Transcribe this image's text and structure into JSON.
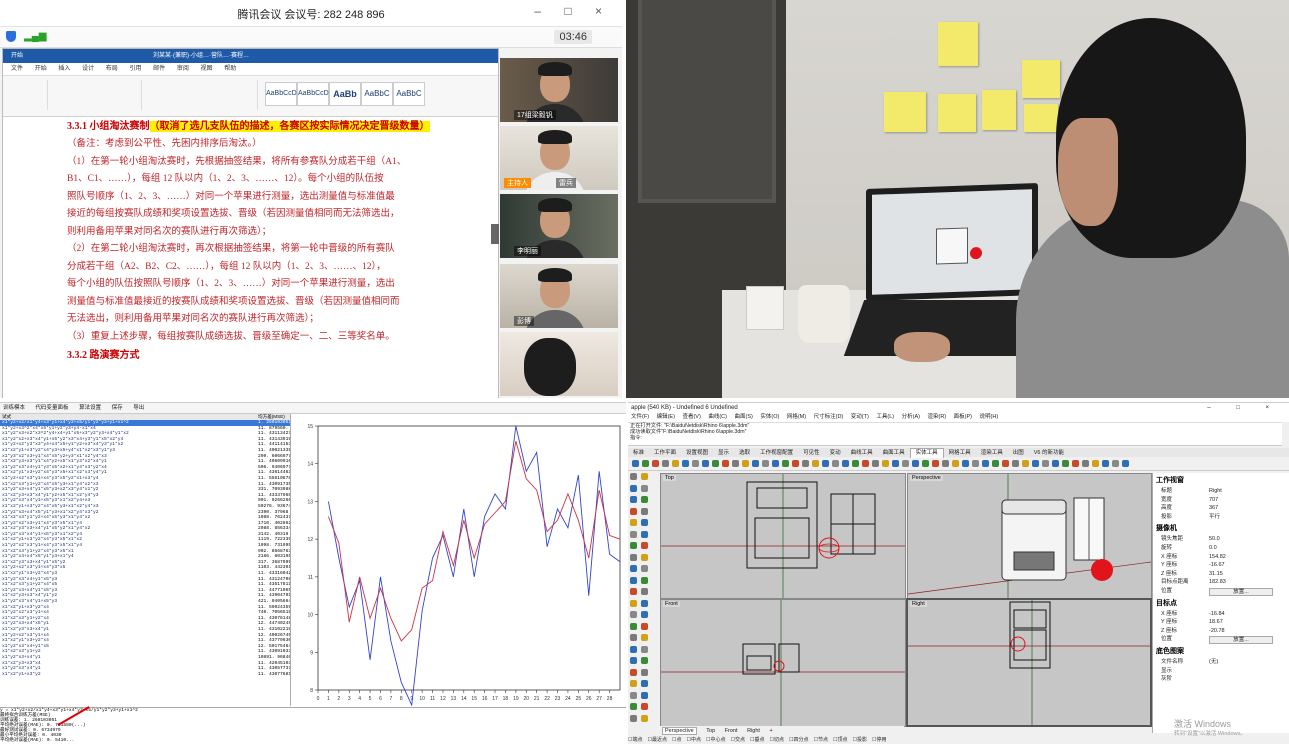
{
  "meeting": {
    "title": "腾讯会议 会议号: 282 248 896",
    "timer": "03:46",
    "window_controls": "– □ ×",
    "doc": {
      "app_label": "开始",
      "doc_name": "刘某某·(兼职)·小组…·营队…·赛程…",
      "tabs": [
        "文件",
        "开始",
        "插入",
        "设计",
        "布局",
        "引用",
        "邮件",
        "审阅",
        "视图",
        "帮助"
      ],
      "styles": [
        "AaBbCcDd",
        "AaBbCcDd",
        "AaBb",
        "AaBbC",
        "AaBbC"
      ],
      "heading_prefix": "3.3.1 小组淘汰赛制",
      "heading_highlight": "（取消了选几支队伍的描述，各赛区按实际情况决定晋级数量）",
      "lines": [
        "（备注：考虑到公平性、先困内排序后淘汰。）",
        "（1）在第一轮小组淘汰赛时，先根据抽签结果，将所有参赛队分成若干组（A1、",
        "B1、C1、……），每组 12 队以内（1、2、3、……、12）。每个小组的队伍按",
        "照队号顺序（1、2、3、……）对同一个苹果进行测量，选出测量值与标准值最",
        "接近的每组按赛队成绩和奖项设置选拔、晋级（若因测量值相同而无法筛选出，",
        "则利用备用苹果对同名次的赛队进行再次筛选）；",
        "（2）在第二轮小组淘汰赛时，再次根据抽签结果，将第一轮中晋级的所有赛队",
        "分成若干组（A2、B2、C2、……），每组 12 队以内（1、2、3、……、12），",
        "每个小组的队伍按照队号顺序（1、2、3、……）对同一个苹果进行测量，选出",
        "测量值与标准值最接近的按赛队成绩和奖项设置选拔、晋级（若因测量值相同而",
        "无法选出，则利用备用苹果对同名次的赛队进行再次筛选）；",
        "（3）重复上述步骤，每组按赛队成绩选拔、晋级至确定一、二、三等奖名单。",
        "3.3.2 路演赛方式"
      ]
    },
    "participants": [
      {
        "name": "17组梁毅钒",
        "host": ""
      },
      {
        "name": "雷兵",
        "host": "主持人"
      },
      {
        "name": "李明丽",
        "host": ""
      },
      {
        "name": "彭博",
        "host": ""
      },
      {
        "name": "",
        "host": ""
      }
    ]
  },
  "stats": {
    "toolbar": [
      "训练模本",
      "代码变量面板",
      "算法设置",
      "保存",
      "导出"
    ],
    "table_header": [
      "试式",
      "均方差(MSE)"
    ],
    "rows": [
      {
        "expr": "x1*y2+x2/x1*y4+x3*y1+x4*y3+x5/y1*y2*y3+y1+x1^2",
        "val": "1. 260103051"
      },
      {
        "expr": "x1*y2+x3^2*x4*x5*y1+y2*y3+y4-x1*x4",
        "val": "11. 879560. 794"
      },
      {
        "expr": "x1*y2*x3+x2*x3^2*y4+x4+y1*x5+x3*y2*y3+x4*y1*x2",
        "val": "11. 43113427"
      },
      {
        "expr": "x1*y2*x2+x3*x4*y1+x5*y2*x3*x4+y3*y1*x5*x2*y4",
        "val": "11. 43143919"
      },
      {
        "expr": "x1*y2+x2*y3*x3*y4+x4*x5+y1*y2+x3*x4*y3*y1*x2",
        "val": "11. 44114153"
      },
      {
        "expr": "x1*x2*y1+x3*y2*x4*y3+x5+y4*x1*x2*x3*y1*y3",
        "val": "11. 40021339"
      },
      {
        "expr": "x1*y3*x2*x3+y1*x4*x5*y2+y3*x1*x2*y4*x3",
        "val": "290. 6066977"
      },
      {
        "expr": "x1*x2*y3+x3*y1*x4*y2+x5*x1*y3*x2*x4*y1",
        "val": "11. 40609916"
      },
      {
        "expr": "x1*y2*x3*x4+y1*y3*x5*x2+x1*y4*x3*y2*x4",
        "val": "506. 9406977"
      },
      {
        "expr": "x1*x2*y1*x3+y2*x4*y3*x5+x1*x2*x3*y4*y1",
        "val": "11. 43614463"
      },
      {
        "expr": "x1*y2+x2*x3*y1+x4*y3*x5*y2*x1+x3*y4",
        "val": "11. 55610878"
      },
      {
        "expr": "x1*x2*x3*y1+y2*x4*x5*y3+x1*y4*x2*x3",
        "val": "11. 43091735"
      },
      {
        "expr": "x1*y2*x3+x4*y1*x5*y3+x2*x3*y4*x1*y2",
        "val": "331. 7093988"
      },
      {
        "expr": "x1*x2*y3+x3*x4*y1*y2+x5*x1*x2*y4*y3",
        "val": "11. 43337968"
      },
      {
        "expr": "x1*y2*x3*x4*y1+x5*y3*x1*x2*y4+x3",
        "val": "901. 9266266"
      },
      {
        "expr": "x1*x2*y1+x3*y2*x4*x5*y3+x1*x2*y4*x3",
        "val": "50276. 93674"
      },
      {
        "expr": "x1*y2*x3+x4*x5*y1*y3+x1*x2*y4*x3*y2",
        "val": "2390. 37968"
      },
      {
        "expr": "x1*x2*x3*y1*y2+x4*x5*y3*x1*y4*x2",
        "val": "1088. 762437"
      },
      {
        "expr": "x1*y2*x2*x3+y1*x4*y3*x5*x1*y4",
        "val": "1710. 402862"
      },
      {
        "expr": "x1*x2*y3*x3+x4*y1*x5*y2*x1*y4*x2",
        "val": "2988. 856334"
      },
      {
        "expr": "x1*y2*x3*x4*y1+x5*y3*x1*x2*y4",
        "val": "3142. 40319"
      },
      {
        "expr": "x1*x2*y1+x3*y2*x4*y3*x5*x1*x2",
        "val": "1119. 722335"
      },
      {
        "expr": "x1*y2*x2*x3*y1+x4*y3*x5*x1*y4",
        "val": "1098. 731995"
      },
      {
        "expr": "x1*x2*x3*y1+y2*x4*y3*x5*x1",
        "val": "902. 8668763"
      },
      {
        "expr": "x1*y2*x3+x4*x5*y1*y3+x1*y4",
        "val": "2186. 603195"
      },
      {
        "expr": "x1*x2*y3*x3+x4*y1*x5*y2",
        "val": "317. 3687999"
      },
      {
        "expr": "x1*y2+x2*x3*y1+x4*y3*x5",
        "val": "1103. 442391"
      },
      {
        "expr": "x1*x2*y1*x3+y2*x4*y3",
        "val": "11. 43316042"
      },
      {
        "expr": "x1*y2*x3*x4+y1*x5*y3",
        "val": "11. 43124708"
      },
      {
        "expr": "x1*x2*x3*y1+y2*x4*x5",
        "val": "11. 43517811"
      },
      {
        "expr": "x1*y2*x3+x4*y1*x5*y3",
        "val": "11. 44771065"
      },
      {
        "expr": "x1*x2*y3+x3*x4*y1*y2",
        "val": "11. 43904701"
      },
      {
        "expr": "x1*y2*x3*x4*y1+x5*y3",
        "val": "421. 0405664"
      },
      {
        "expr": "x1*x2*y1+x3*y2*x4",
        "val": "11. 59024359"
      },
      {
        "expr": "x1*y2*x2*x3*y1+x4",
        "val": "740. 7056519"
      },
      {
        "expr": "x1*x2*x3*y1+y2*x4",
        "val": "11. 43076148"
      },
      {
        "expr": "x1*y2*x3+x4*x5*y1",
        "val": "12. 44740249"
      },
      {
        "expr": "x1*x2*y3*x3+x4*y1",
        "val": "11. 43102218"
      },
      {
        "expr": "x1*y2+x2*x3*y1+x4",
        "val": "12. 40026745"
      },
      {
        "expr": "x1*x2*y1*x3+y2*x4",
        "val": "11. 43779630"
      },
      {
        "expr": "x1*y2*x3*x4+y1*x5",
        "val": "12. 50175464"
      },
      {
        "expr": "x1*x2*x3*y1+y2",
        "val": "11. 43091033"
      },
      {
        "expr": "x1*y2*x3+x4*y1",
        "val": "10891. 96846"
      },
      {
        "expr": "x1*x2*y3+x3*x4",
        "val": "11. 42045103"
      },
      {
        "expr": "x1*y2*x3*x4*y1",
        "val": "11. 43057737"
      },
      {
        "expr": "x1*x2*y1+x3*y2",
        "val": "11. 43077681"
      }
    ],
    "console": [
      "y = x1*y2+x2/x1*y4+x3*y1+x4*y3+x5/y1*y2*y3+y1+x1^2",
      "最终拟合训练方差(MSE)",
      "训练误差:  1. 260103051",
      "平均绝对误差(MAE):  0. 731580(...)",
      "最好测试误差:  0. 6734979",
      "最小平均绝对误差:  0. 4030",
      "平均绝对误差(MAE):  0. 5410..."
    ]
  },
  "chart_data": {
    "type": "line",
    "title": "",
    "xlabel": "",
    "ylabel": "",
    "x": [
      1,
      2,
      3,
      4,
      5,
      6,
      7,
      8,
      9,
      10,
      11,
      12,
      13,
      14,
      15,
      16,
      17,
      18,
      19,
      20,
      21,
      22,
      23,
      24,
      25,
      26,
      27,
      28,
      29
    ],
    "xlim": [
      0,
      29
    ],
    "ylim": [
      8,
      15
    ],
    "yticks": [
      8,
      9,
      10,
      11,
      12,
      13,
      14,
      15
    ],
    "xticks": [
      0,
      1,
      2,
      3,
      4,
      5,
      6,
      7,
      8,
      9,
      10,
      11,
      12,
      13,
      14,
      15,
      16,
      17,
      18,
      19,
      20,
      21,
      22,
      23,
      24,
      25,
      26,
      27,
      28
    ],
    "series": [
      {
        "color": "#3344cc",
        "values": [
          13.0,
          11.5,
          10.2,
          10.9,
          8.8,
          11.0,
          9.3,
          8.2,
          7.6,
          10.1,
          11.5,
          12.1,
          11.0,
          12.8,
          11.0,
          12.6,
          13.2,
          12.8,
          15.0,
          13.8,
          14.3,
          11.8,
          12.8,
          12.3,
          13.7,
          10.5,
          13.8,
          11.6,
          11.4
        ]
      },
      {
        "color": "#cc3344",
        "values": [
          12.6,
          11.9,
          9.8,
          11.0,
          9.9,
          10.7,
          9.9,
          9.3,
          9.6,
          10.7,
          10.9,
          12.2,
          11.3,
          12.5,
          11.5,
          12.4,
          12.7,
          13.0,
          14.6,
          13.6,
          13.3,
          12.2,
          12.5,
          13.2,
          12.5,
          11.5,
          13.3,
          12.1,
          12.0
        ]
      }
    ]
  },
  "rhino": {
    "title": "apple (540 KB) - Undefined 6 Undefined",
    "window_controls": "– □ ×",
    "menu": [
      "文件(F)",
      "编辑(E)",
      "查看(V)",
      "曲线(C)",
      "曲面(S)",
      "实体(O)",
      "网格(M)",
      "尺寸标注(D)",
      "变动(T)",
      "工具(L)",
      "分析(A)",
      "渲染(R)",
      "面板(P)",
      "说明(H)"
    ],
    "cmd_lines": [
      "正在打开文件: \"F:\\BaiduNetdisk\\Rhino 6\\apple.3dm\"",
      "成功读取文件\"F:\\BaiduNetdisk\\Rhino 6\\apple.3dm\"",
      "指令:"
    ],
    "tabs": [
      "标准",
      "工作平面",
      "设置视图",
      "显示",
      "选取",
      "工作视窗配置",
      "可见性",
      "变动",
      "曲线工具",
      "曲面工具",
      "实体工具",
      "网格工具",
      "渲染工具",
      "出图",
      "V6 的新功能"
    ],
    "active_tab": "实体工具",
    "viewports": [
      "Top",
      "Perspective",
      "Front",
      "Right"
    ],
    "vpbar": [
      "Perspective",
      "Top",
      "Front",
      "Right"
    ],
    "osnap": [
      "端点",
      "最近点",
      "点",
      "中点",
      "中心点",
      "交点",
      "垂点",
      "切点",
      "四分点",
      "节点",
      "顶点",
      "投影",
      "停用"
    ],
    "panel": {
      "title1": "工作视窗",
      "rows1": [
        [
          "标题",
          "Right"
        ],
        [
          "宽度",
          "707"
        ],
        [
          "高度",
          "367"
        ],
        [
          "投影",
          "平行"
        ]
      ],
      "title2": "摄像机",
      "rows2": [
        [
          "镜头焦距",
          "50.0"
        ],
        [
          "旋转",
          "0.0"
        ],
        [
          "X 座标",
          "154.82"
        ],
        [
          "Y 座标",
          "-16.67"
        ],
        [
          "Z 座标",
          "31.15"
        ],
        [
          "目标点距离",
          "182.83"
        ]
      ],
      "pos_label": "位置",
      "place_btn": "放置...",
      "title3": "目标点",
      "rows3": [
        [
          "X 座标",
          "-16.84"
        ],
        [
          "Y 座标",
          "18.67"
        ],
        [
          "Z 座标",
          "-20.78"
        ]
      ],
      "title4": "底色图案",
      "rows4": [
        [
          "文件名称",
          "(无)"
        ],
        [
          "显示",
          ""
        ],
        [
          "灰阶",
          ""
        ]
      ]
    },
    "watermark": "激活 Windows",
    "watermark_sub": "转到\"设置\"以激活 Windows。"
  }
}
